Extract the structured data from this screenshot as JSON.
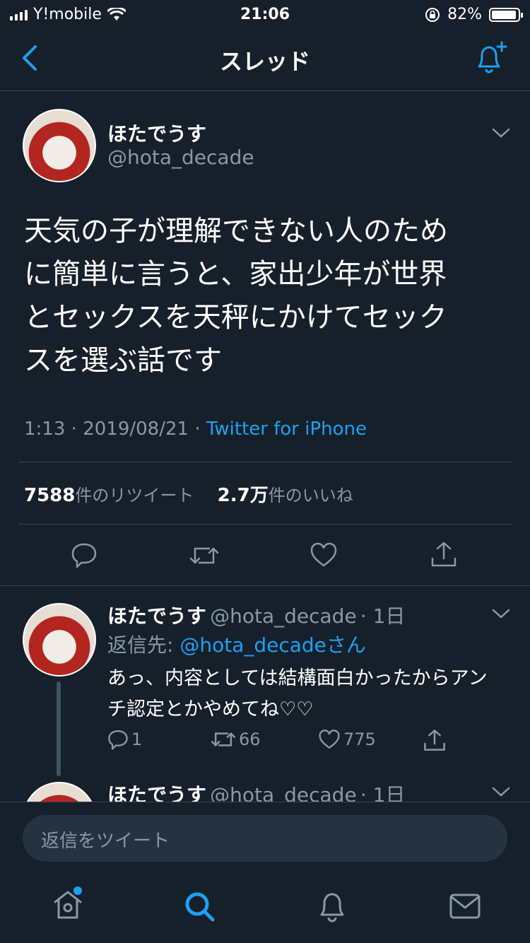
{
  "status_bar": {
    "carrier": "Y!mobile",
    "time": "21:06",
    "battery": "82%"
  },
  "header": {
    "title": "スレッド"
  },
  "main_tweet": {
    "name": "ほたでうす",
    "handle": "@hota_decade",
    "text_lines": [
      "天気の子が理解できない人のため",
      "に簡単に言うと、家出少年が世界",
      "とセックスを天秤にかけてセック",
      "スを選ぶ話です"
    ],
    "time": "1:13",
    "date": "2019/08/21",
    "separator": "·",
    "source": "Twitter for iPhone",
    "retweet_count": "7588",
    "retweet_label": "件のリツイート",
    "like_count": "2.7万",
    "like_label": "件のいいね"
  },
  "reply_tweet": {
    "name": "ほたでうす",
    "handle": "@hota_decade",
    "age": "· 1日",
    "reply_to_label": "返信先: ",
    "reply_to_handle": "@hota_decadeさん",
    "text_lines": [
      "あっ、内容としては結構面白かったからアン",
      "チ認定とかやめてね♡♡"
    ],
    "reply_count": "1",
    "retweet_count": "66",
    "like_count": "775"
  },
  "third_tweet": {
    "name": "ほたでうす",
    "handle": "@hota_decade",
    "age": "· 1日"
  },
  "composer": {
    "placeholder": "返信をツイート"
  },
  "colors": {
    "background": "#15202b",
    "accent": "#1da1f2",
    "muted": "#8899a6",
    "divider": "#38444d"
  }
}
